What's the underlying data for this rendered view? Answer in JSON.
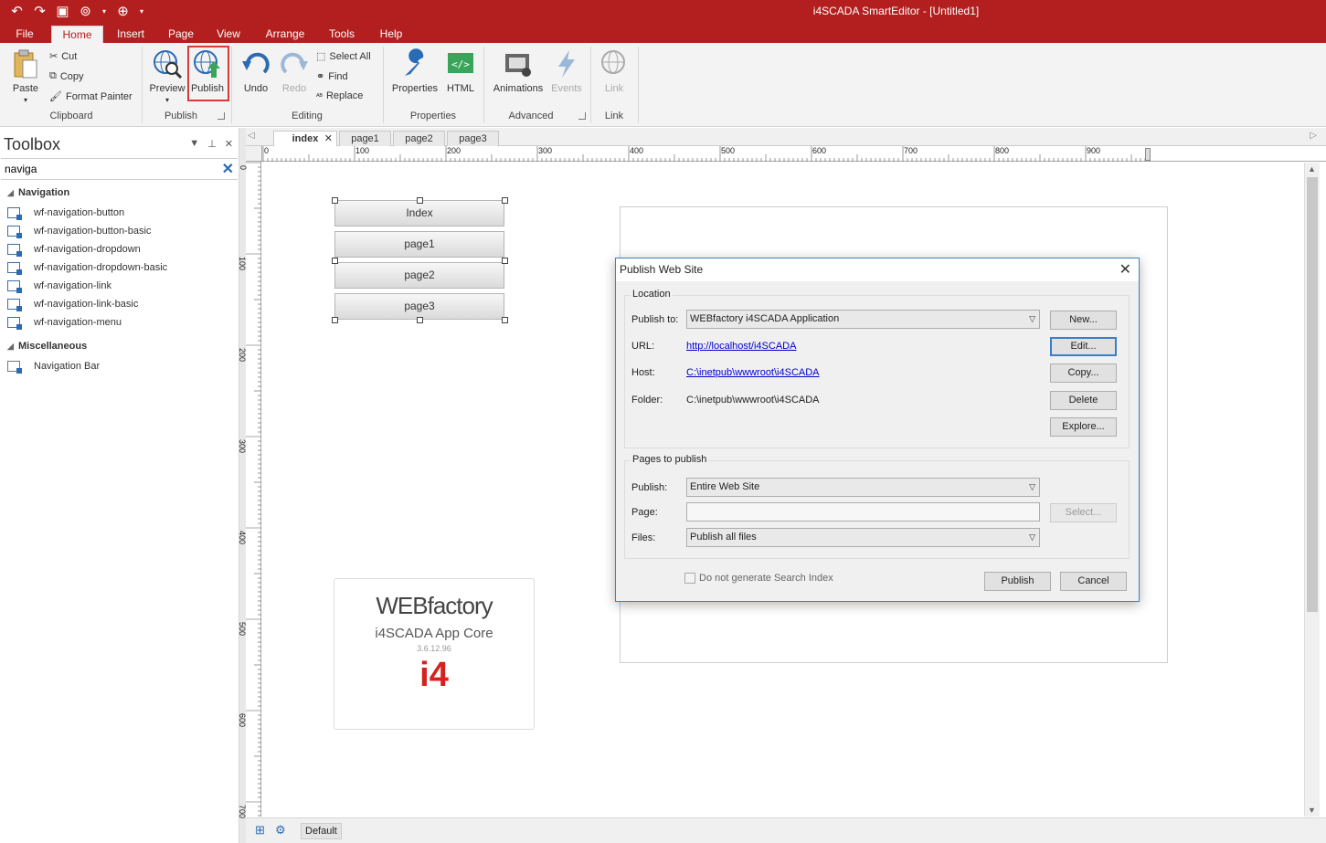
{
  "window": {
    "title": "i4SCADA SmartEditor - [Untitled1]"
  },
  "menu": {
    "tabs": [
      "File",
      "Home",
      "Insert",
      "Page",
      "View",
      "Arrange",
      "Tools",
      "Help"
    ],
    "active": "Home"
  },
  "ribbon": {
    "clipboard": {
      "paste": "Paste",
      "cut": "Cut",
      "copy": "Copy",
      "format_painter": "Format Painter",
      "label": "Clipboard"
    },
    "publish": {
      "preview": "Preview",
      "publish": "Publish",
      "label": "Publish"
    },
    "editing": {
      "undo": "Undo",
      "redo": "Redo",
      "select_all": "Select All",
      "find": "Find",
      "replace": "Replace",
      "label": "Editing"
    },
    "properties": {
      "properties": "Properties",
      "html": "HTML",
      "label": "Properties"
    },
    "advanced": {
      "animations": "Animations",
      "events": "Events",
      "label": "Advanced"
    },
    "link": {
      "link": "Link",
      "label": "Link"
    }
  },
  "toolbox": {
    "title": "Toolbox",
    "search": "naviga",
    "categories": [
      {
        "name": "Navigation",
        "items": [
          "wf-navigation-button",
          "wf-navigation-button-basic",
          "wf-navigation-dropdown",
          "wf-navigation-dropdown-basic",
          "wf-navigation-link",
          "wf-navigation-link-basic",
          "wf-navigation-menu"
        ]
      },
      {
        "name": "Miscellaneous",
        "items": [
          "Navigation Bar"
        ]
      }
    ]
  },
  "doc_tabs": [
    "index",
    "page1",
    "page2",
    "page3"
  ],
  "ruler": {
    "h": [
      "0",
      "100",
      "200",
      "300",
      "400",
      "500",
      "600",
      "700",
      "800",
      "900"
    ],
    "v": [
      "0",
      "100",
      "200",
      "300",
      "400",
      "500",
      "600",
      "700"
    ]
  },
  "canvas": {
    "buttons": [
      "Index",
      "page1",
      "page2",
      "page3"
    ],
    "logo": {
      "brand": "WEBfactory",
      "product": "i4SCADA App Core",
      "version": "3.6.12.96",
      "mark": "i4"
    }
  },
  "dialog": {
    "title": "Publish Web Site",
    "location": {
      "legend": "Location",
      "publish_to_label": "Publish to:",
      "publish_to_value": "WEBfactory i4SCADA Application",
      "url_label": "URL:",
      "url_value": "http://localhost/i4SCADA",
      "host_label": "Host:",
      "host_value": "C:\\inetpub\\wwwroot\\i4SCADA",
      "folder_label": "Folder:",
      "folder_value": "C:\\inetpub\\wwwroot\\i4SCADA",
      "buttons": {
        "new": "New...",
        "edit": "Edit...",
        "copy": "Copy...",
        "delete": "Delete",
        "explore": "Explore..."
      }
    },
    "pages": {
      "legend": "Pages to publish",
      "publish_label": "Publish:",
      "publish_value": "Entire Web Site",
      "page_label": "Page:",
      "page_value": "",
      "files_label": "Files:",
      "files_value": "Publish all files",
      "select_button": "Select..."
    },
    "no_search_index": "Do not generate Search Index",
    "publish_button": "Publish",
    "cancel_button": "Cancel"
  },
  "status": {
    "layer": "Default"
  }
}
